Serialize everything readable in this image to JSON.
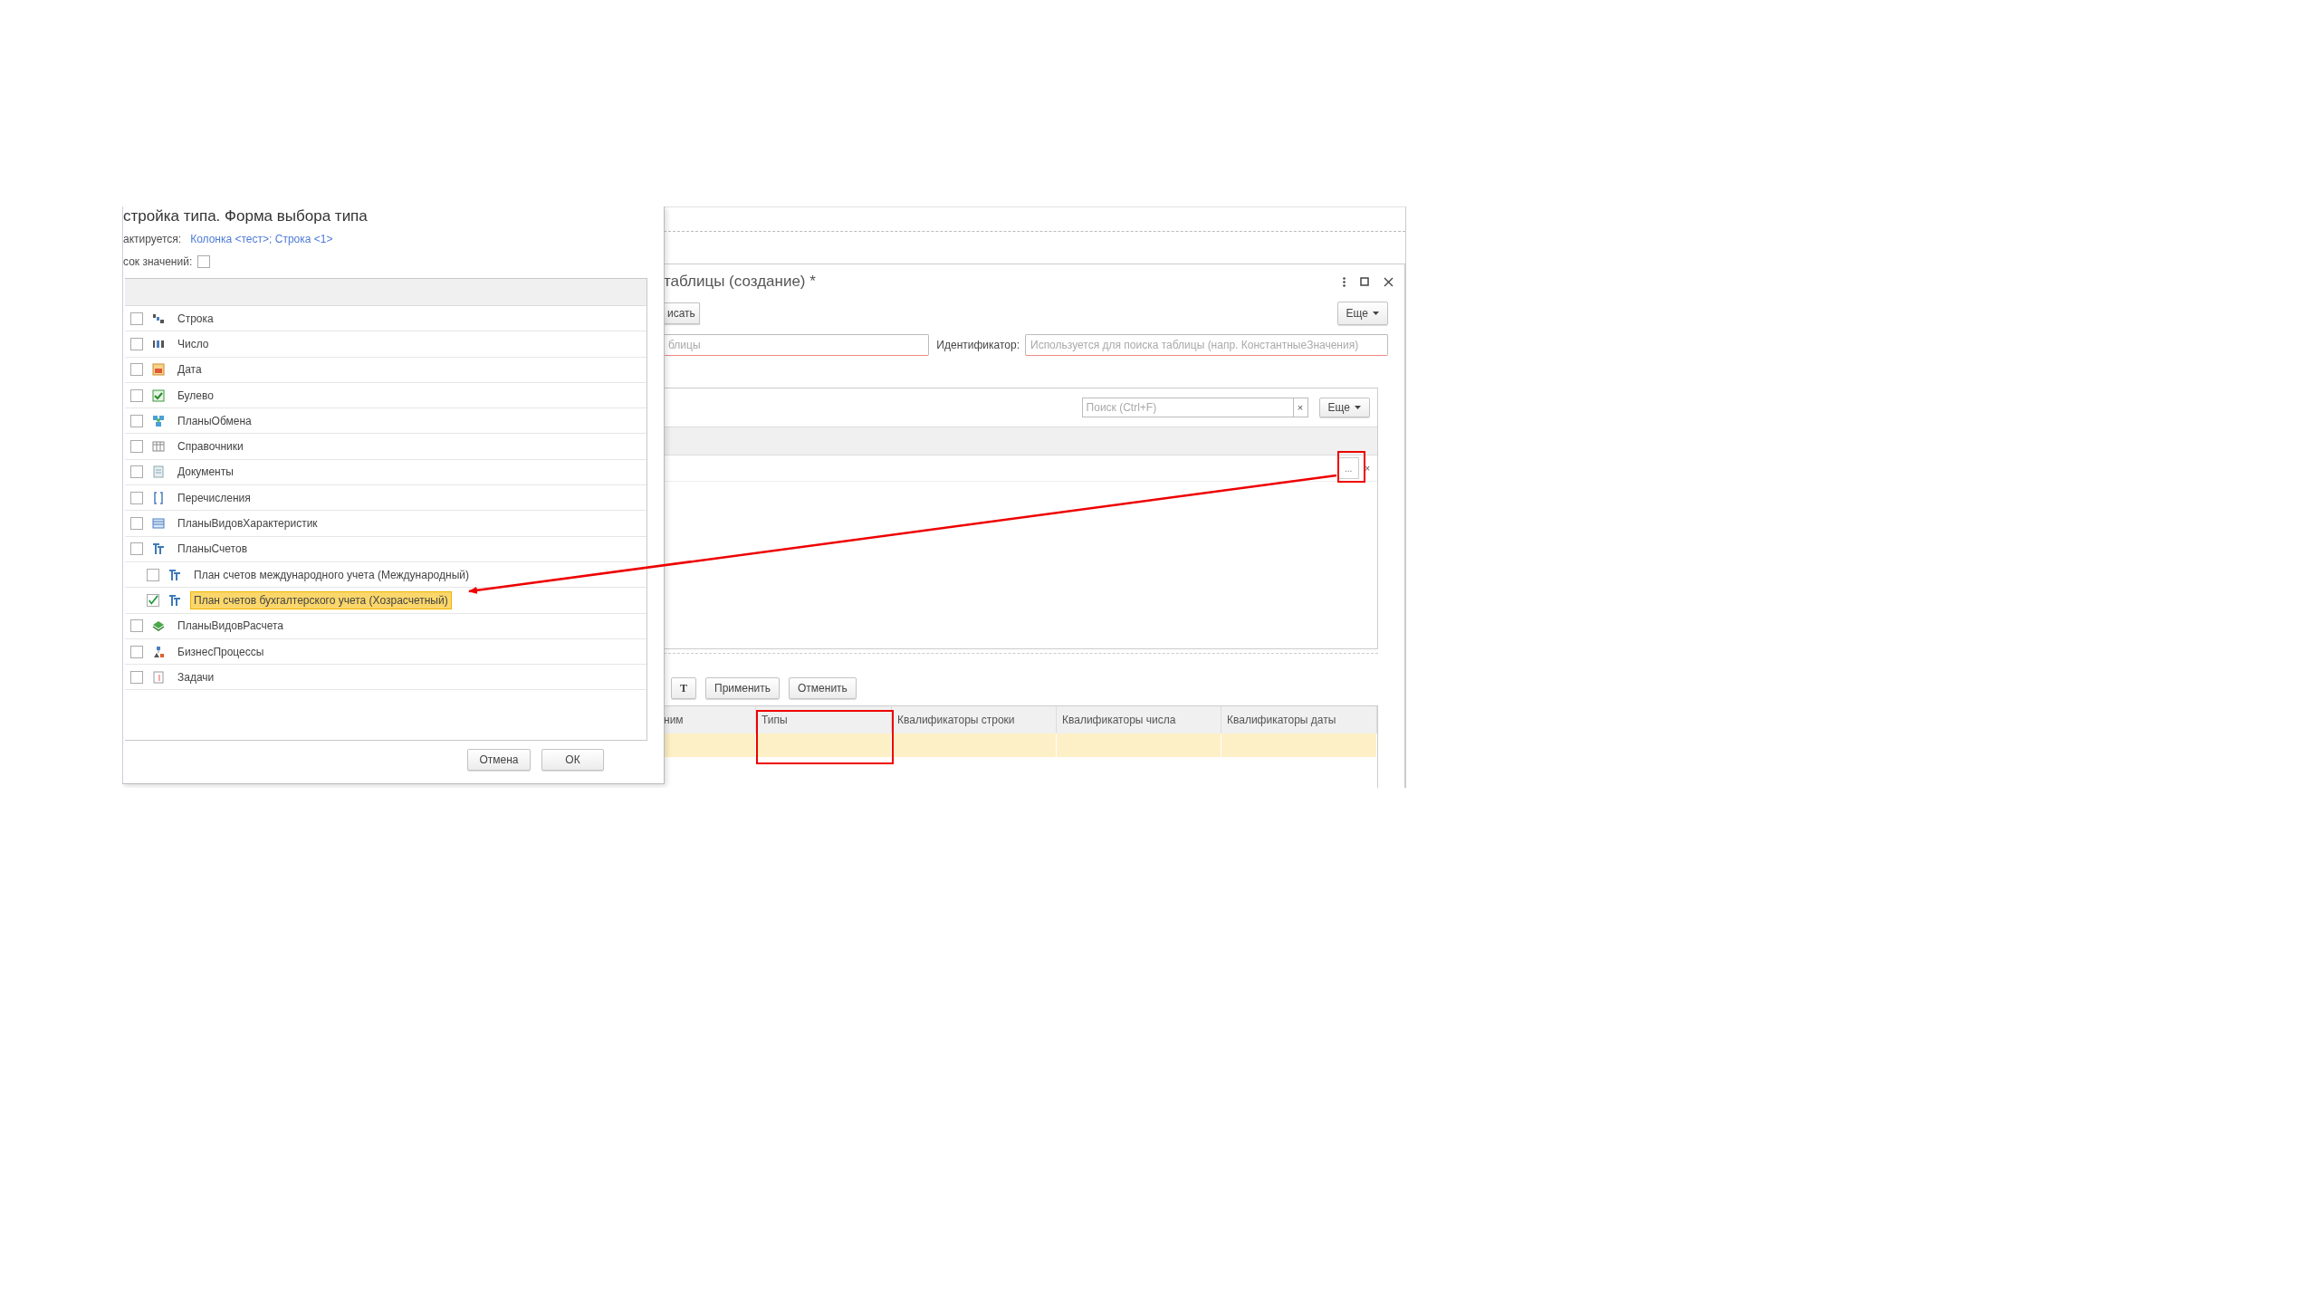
{
  "dialog": {
    "title": "стройка типа. Форма выбора типа",
    "context_label": "актируется:",
    "context_link": "Колонка <тест>; Строка <1>",
    "value_list_label": "сок значений:",
    "value_list_checked": false,
    "types": [
      {
        "label": "Строка",
        "kind": "string",
        "checked": false,
        "selected": false
      },
      {
        "label": "Число",
        "kind": "number",
        "checked": false,
        "selected": false
      },
      {
        "label": "Дата",
        "kind": "date",
        "checked": false,
        "selected": false
      },
      {
        "label": "Булево",
        "kind": "boolean",
        "checked": false,
        "selected": false
      },
      {
        "label": "ПланыОбмена",
        "kind": "exchange",
        "checked": false,
        "selected": false
      },
      {
        "label": "Справочники",
        "kind": "catalog",
        "checked": false,
        "selected": false
      },
      {
        "label": "Документы",
        "kind": "document",
        "checked": false,
        "selected": false
      },
      {
        "label": "Перечисления",
        "kind": "enum",
        "checked": false,
        "selected": false
      },
      {
        "label": "ПланыВидовХарактеристик",
        "kind": "chart",
        "checked": false,
        "selected": false
      },
      {
        "label": "ПланыСчетов",
        "kind": "accounts",
        "checked": false,
        "selected": false,
        "children": [
          {
            "label": "План счетов международного учета (Международный)",
            "kind": "accounts",
            "checked": false,
            "selected": false
          },
          {
            "label": "План счетов бухгалтерского учета (Хозрасчетный)",
            "kind": "accounts",
            "checked": true,
            "selected": true
          }
        ]
      },
      {
        "label": "ПланыВидовРасчета",
        "kind": "calc",
        "checked": false,
        "selected": false
      },
      {
        "label": "БизнесПроцессы",
        "kind": "process",
        "checked": false,
        "selected": false
      },
      {
        "label": "Задачи",
        "kind": "task",
        "checked": false,
        "selected": false
      }
    ],
    "buttons": [
      "Отмена",
      "ОК"
    ]
  },
  "window": {
    "title": "таблицы (создание) *",
    "save_button": "исать",
    "more_button": "Еще",
    "name_placeholder": "блицы",
    "identifier_label": "Идентификатор:",
    "identifier_placeholder": "Используется для поиска таблицы (напр. КонстантныеЗначения)",
    "list": {
      "search_placeholder": "Поиск (Ctrl+F)",
      "search_clear": "×",
      "more_button": "Еще",
      "row_button": "...",
      "row_clear": "×"
    },
    "toolbar": [
      "T",
      "Применить",
      "Отменить"
    ],
    "table": {
      "columns": [
        "ним",
        "Типы",
        "Квалификаторы строки",
        "Квалификаторы числа",
        "Квалификаторы даты"
      ],
      "rows": [
        {
          "selected": true
        }
      ]
    }
  }
}
